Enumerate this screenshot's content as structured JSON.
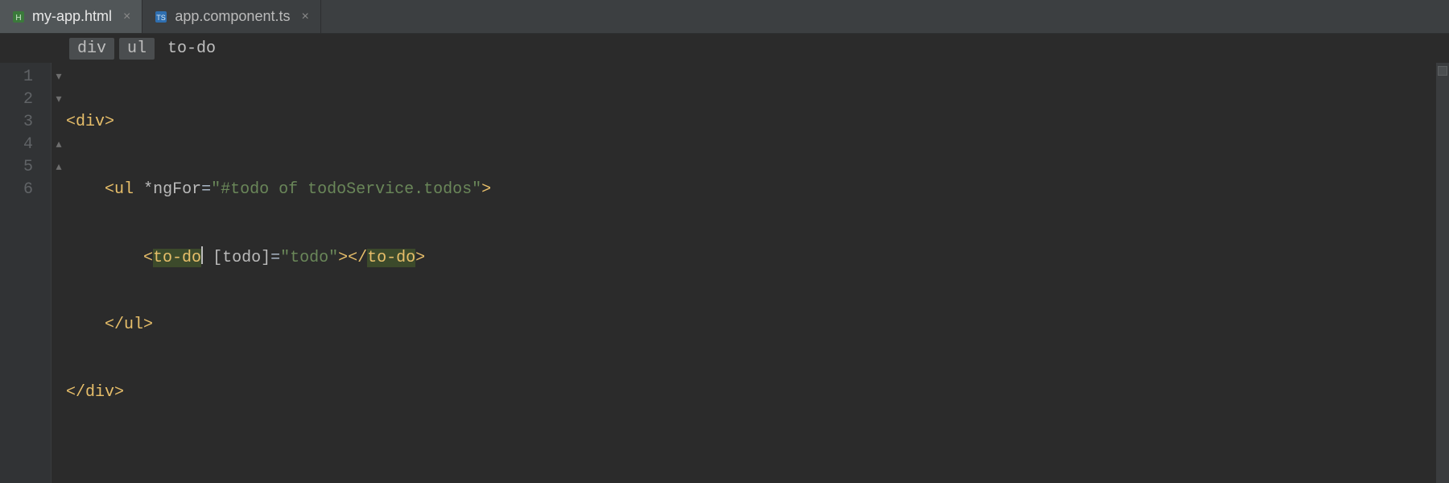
{
  "tabs": [
    {
      "label": "my-app.html",
      "active": true,
      "icon": "html"
    },
    {
      "label": "app.component.ts",
      "active": false,
      "icon": "ts"
    }
  ],
  "breadcrumb": [
    "div",
    "ul",
    "to-do"
  ],
  "line_numbers": [
    "1",
    "2",
    "3",
    "4",
    "5",
    "6"
  ],
  "fold_markers": [
    "open",
    "open",
    "none",
    "close",
    "close",
    "none"
  ],
  "code": {
    "l1": {
      "t1": "<",
      "t2": "div",
      "t3": ">"
    },
    "l2": {
      "indent": "    ",
      "t1": "<",
      "t2": "ul",
      "sp": " ",
      "a1": "*ngFor",
      "eq": "=",
      "s1": "\"#todo of todoService.todos\"",
      "t3": ">"
    },
    "l3": {
      "indent": "        ",
      "openlt": "<",
      "open": "to-do",
      "sp": " ",
      "a1": "[todo]",
      "eq": "=",
      "s1": "\"todo\"",
      "gt": ">",
      "closelt": "</",
      "close": "to-do",
      "closegt": ">"
    },
    "l4": {
      "indent": "    ",
      "t1": "</",
      "t2": "ul",
      "t3": ">"
    },
    "l5": {
      "t1": "</",
      "t2": "div",
      "t3": ">"
    }
  },
  "caret": {
    "line": 3,
    "after_text": "to-do"
  }
}
